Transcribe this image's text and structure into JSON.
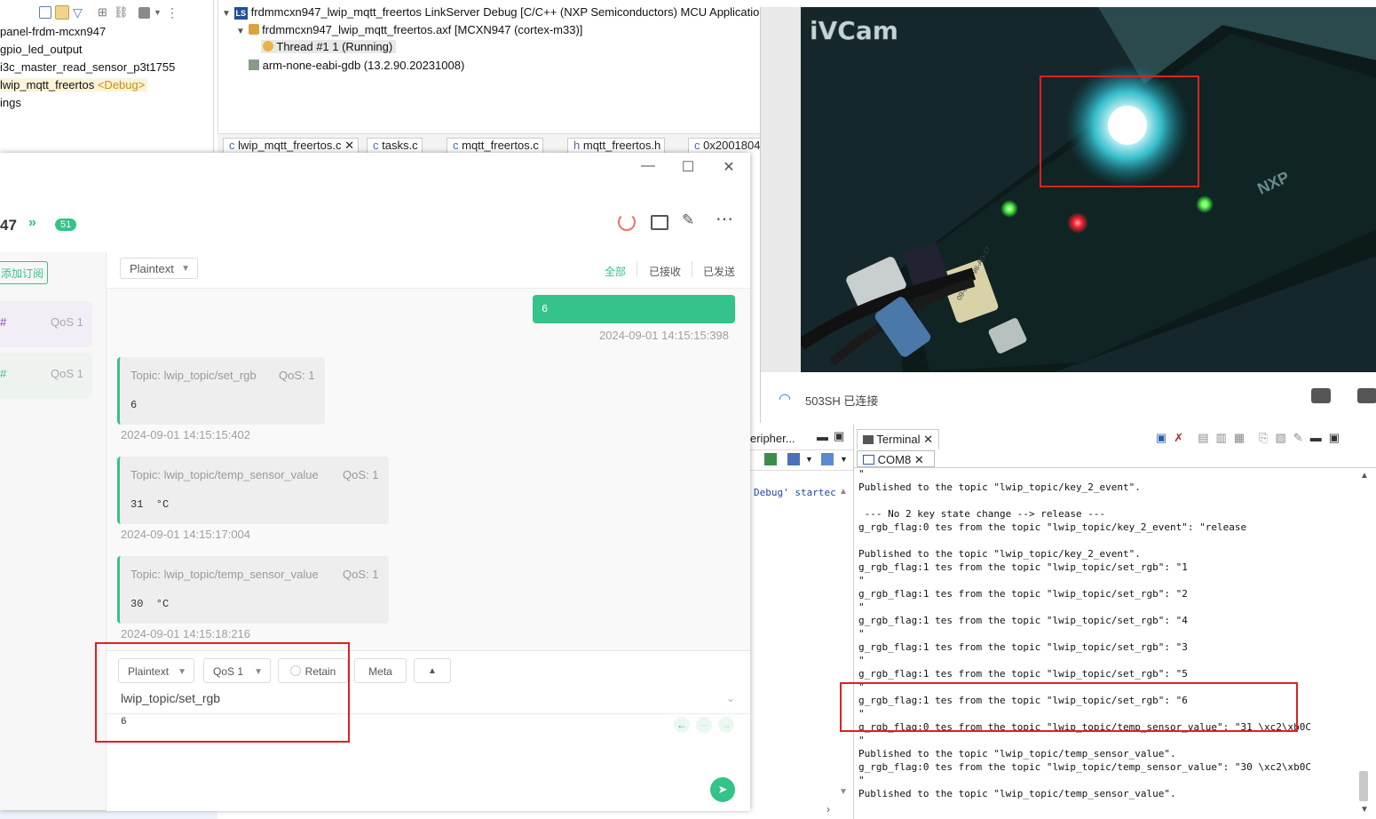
{
  "project_explorer": {
    "items": [
      "panel-frdm-mcxn947",
      "gpio_led_output",
      "i3c_master_read_sensor_p3t1755",
      "lwip_mqtt_freertos",
      "ings"
    ],
    "debug_badge": "<Debug>"
  },
  "debug_view": {
    "launch": "frdmmcxn947_lwip_mqtt_freertos LinkServer Debug [C/C++ (NXP Semiconductors) MCU Applicatio",
    "process": "frdmmcxn947_lwip_mqtt_freertos.axf [MCXN947 (cortex-m33)]",
    "thread": "Thread #1 1 (Running)",
    "gdb": "arm-none-eabi-gdb (13.2.90.20231008)",
    "ls_badge": "LS"
  },
  "editor_tabs": [
    "lwip_mqtt_freertos.c",
    "tasks.c",
    "mqtt_freertos.c",
    "mqtt_freertos.h",
    "0x2001804"
  ],
  "mqttx": {
    "window_controls": {
      "minimize": "—",
      "maximize": "☐",
      "close": "✕"
    },
    "connection_name": "47",
    "connection_badge": "51",
    "new_subscription": "添加订阅",
    "subscriptions": [
      {
        "prefix": "#",
        "qos": "QoS 1",
        "color": "#8e44ad"
      },
      {
        "prefix": "#",
        "qos": "QoS 1",
        "color": "#34c388"
      }
    ],
    "filter": {
      "format": "Plaintext",
      "all": "全部",
      "received": "已接收",
      "sent": "已发送"
    },
    "messages": [
      {
        "kind": "sent",
        "payload": "6",
        "time": "2024-09-01 14:15:15:398"
      },
      {
        "kind": "recv",
        "topic": "Topic: lwip_topic/set_rgb",
        "qos": "QoS: 1",
        "payload": "6",
        "time": "2024-09-01 14:15:15:402"
      },
      {
        "kind": "recv",
        "topic": "Topic: lwip_topic/temp_sensor_value",
        "qos": "QoS: 1",
        "payload": "31  °C",
        "time": "2024-09-01 14:15:17:004"
      },
      {
        "kind": "recv",
        "topic": "Topic: lwip_topic/temp_sensor_value",
        "qos": "QoS: 1",
        "payload": "30  °C",
        "time": "2024-09-01 14:15:18:216"
      }
    ],
    "compose": {
      "format": "Plaintext",
      "qos": "QoS 1",
      "retain": "Retain",
      "meta": "Meta",
      "topic": "lwip_topic/set_rgb",
      "payload": "6"
    },
    "accent_color": "#34c388"
  },
  "ivcam": {
    "watermark": "iVCam",
    "wifi_status": "503SH 已连接",
    "board_label": "NXP",
    "sticker": "09-04-48 98-AD-17"
  },
  "console_tab": {
    "label": "eripher...",
    "text": "Debug' startec"
  },
  "terminal": {
    "tab": "Terminal",
    "sub_tab": "COM8",
    "lines": [
      "\"",
      "Published to the topic \"lwip_topic/key_2_event\".",
      "",
      " --- No 2 key state change --> release ---",
      "g_rgb_flag:0 tes from the topic \"lwip_topic/key_2_event\": \"release",
      "",
      "Published to the topic \"lwip_topic/key_2_event\".",
      "g_rgb_flag:1 tes from the topic \"lwip_topic/set_rgb\": \"1",
      "\"",
      "g_rgb_flag:1 tes from the topic \"lwip_topic/set_rgb\": \"2",
      "\"",
      "g_rgb_flag:1 tes from the topic \"lwip_topic/set_rgb\": \"4",
      "\"",
      "g_rgb_flag:1 tes from the topic \"lwip_topic/set_rgb\": \"3",
      "\"",
      "g_rgb_flag:1 tes from the topic \"lwip_topic/set_rgb\": \"5",
      "\"",
      "g_rgb_flag:1 tes from the topic \"lwip_topic/set_rgb\": \"6",
      "\"",
      "g_rgb_flag:0 tes from the topic \"lwip_topic/temp_sensor_value\": \"31 \\xc2\\xb0C",
      "\"",
      "Published to the topic \"lwip_topic/temp_sensor_value\".",
      "g_rgb_flag:0 tes from the topic \"lwip_topic/temp_sensor_value\": \"30 \\xc2\\xb0C",
      "\"",
      "Published to the topic \"lwip_topic/temp_sensor_value\"."
    ]
  }
}
